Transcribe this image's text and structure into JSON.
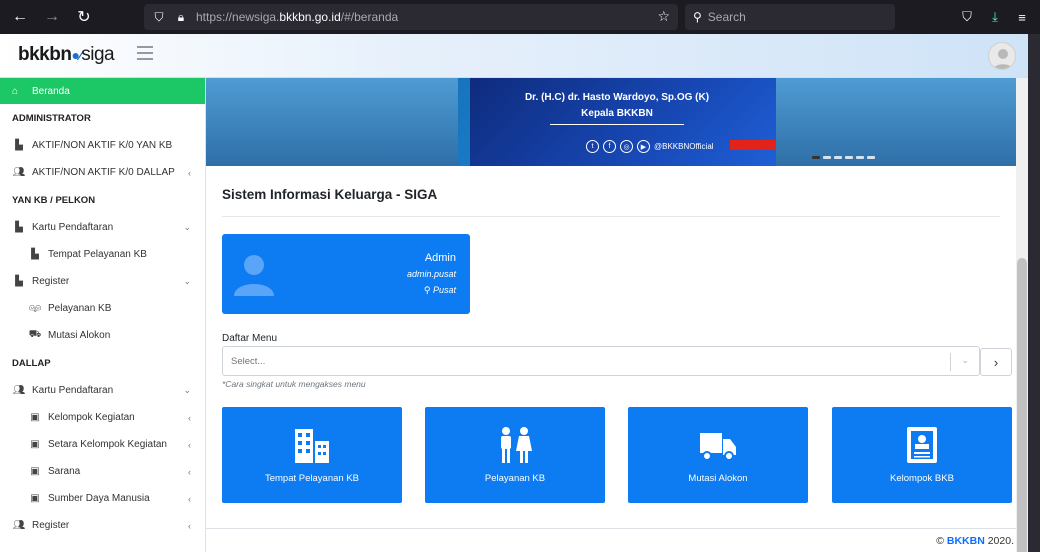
{
  "browser": {
    "url_prefix": "https://newsiga.",
    "url_host": "bkkbn.go.id",
    "url_path": "/#/beranda",
    "search_placeholder": "Search"
  },
  "app": {
    "logo_text": "bkkbn",
    "logo_suffix": "siga"
  },
  "sidebar": {
    "active": {
      "label": "Beranda",
      "icon": "home-icon"
    },
    "sections": [
      {
        "heading": "ADMINISTRATOR"
      },
      {
        "heading": "YAN KB / PELKON"
      },
      {
        "heading": "DALLAP"
      }
    ],
    "items": [
      {
        "label": "AKTIF/NON AKTIF K/0 YAN KB",
        "icon": "building-icon"
      },
      {
        "label": "AKTIF/NON AKTIF K/0 DALLAP",
        "icon": "users-icon"
      },
      {
        "label": "Kartu Pendaftaran",
        "icon": "building-icon"
      },
      {
        "label": "Tempat Pelayanan KB",
        "icon": "building-icon"
      },
      {
        "label": "Register",
        "icon": "building-icon"
      },
      {
        "label": "Pelayanan KB",
        "icon": "people-icon"
      },
      {
        "label": "Mutasi Alokon",
        "icon": "truck-icon"
      },
      {
        "label": "Kartu Pendaftaran",
        "icon": "users-icon"
      },
      {
        "label": "Kelompok Kegiatan",
        "icon": "book-icon"
      },
      {
        "label": "Setara Kelompok Kegiatan",
        "icon": "book-icon"
      },
      {
        "label": "Sarana",
        "icon": "book-icon"
      },
      {
        "label": "Sumber Daya Manusia",
        "icon": "book-icon"
      },
      {
        "label": "Register",
        "icon": "users-icon"
      }
    ]
  },
  "banner": {
    "name": "Dr. (H.C) dr. Hasto Wardoyo, Sp.OG (K)",
    "role": "Kepala BKKBN",
    "handle": "@BKKBNOfficial"
  },
  "main": {
    "title": "Sistem Informasi Keluarga - SIGA",
    "user": {
      "name": "Admin",
      "username": "admin.pusat",
      "level": "Pusat"
    },
    "menu_label": "Daftar Menu",
    "menu_placeholder": "Select...",
    "menu_hint": "*Cara singkat untuk mengakses menu",
    "tiles": [
      {
        "label": "Tempat Pelayanan KB",
        "icon": "building-icon"
      },
      {
        "label": "Pelayanan KB",
        "icon": "family-icon"
      },
      {
        "label": "Mutasi Alokon",
        "icon": "truck-icon"
      },
      {
        "label": "Kelompok BKB",
        "icon": "id-card-icon"
      }
    ]
  },
  "footer": {
    "copyright": "©",
    "brand": "BKKBN",
    "year": "2020."
  },
  "colors": {
    "primary": "#0d7bf2",
    "active_green": "#1cc766"
  }
}
